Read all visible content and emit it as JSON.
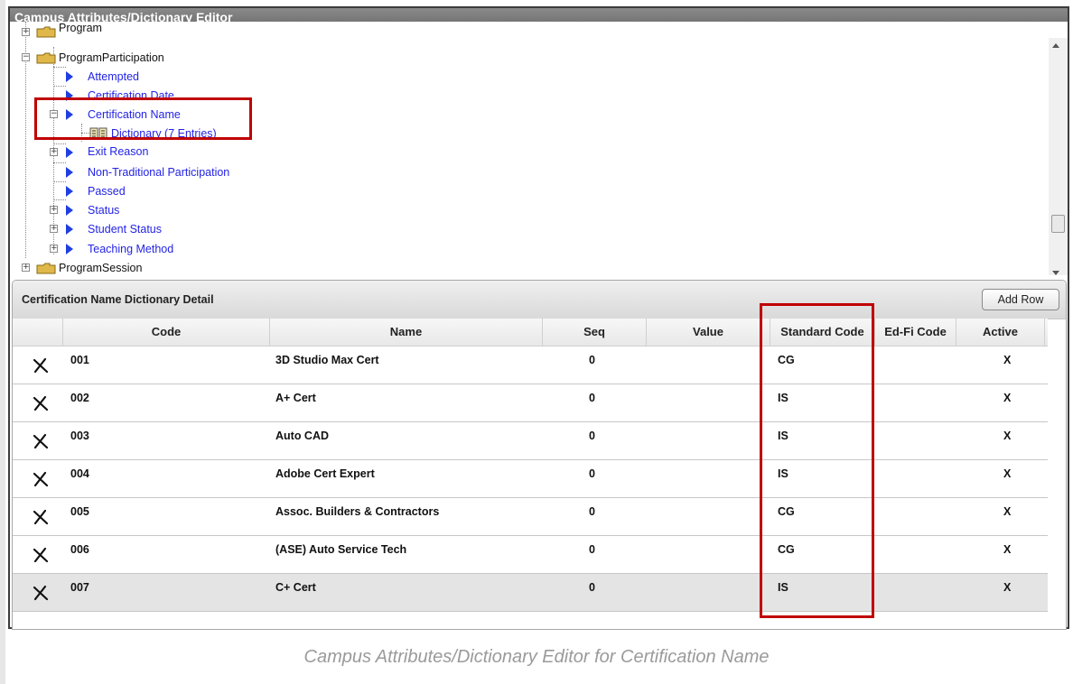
{
  "window": {
    "title": "Campus Attributes/Dictionary Editor"
  },
  "tree": {
    "items": [
      {
        "label": "Program",
        "kind": "folder",
        "expander": "+"
      },
      {
        "label": "ProgramParticipation",
        "kind": "folder",
        "expander": "−"
      },
      {
        "label": "Attempted",
        "kind": "attribute"
      },
      {
        "label": "Certification Date",
        "kind": "attribute"
      },
      {
        "label": "Certification Name",
        "kind": "attribute",
        "expander": "−"
      },
      {
        "label": "Dictionary (7 Entries)",
        "kind": "dictionary"
      },
      {
        "label": "Exit Reason",
        "kind": "attribute",
        "expander": "+"
      },
      {
        "label": "Non-Traditional Participation",
        "kind": "attribute"
      },
      {
        "label": "Passed",
        "kind": "attribute"
      },
      {
        "label": "Status",
        "kind": "attribute",
        "expander": "+"
      },
      {
        "label": "Student Status",
        "kind": "attribute",
        "expander": "+"
      },
      {
        "label": "Teaching Method",
        "kind": "attribute",
        "expander": "+"
      },
      {
        "label": "ProgramSession",
        "kind": "folder",
        "expander": "+"
      }
    ]
  },
  "detail": {
    "title": "Certification Name Dictionary Detail",
    "add_row_label": "Add Row",
    "columns": [
      "Code",
      "Name",
      "Seq",
      "Value",
      "Standard Code",
      "Ed-Fi Code",
      "Active"
    ],
    "rows": [
      {
        "code": "001",
        "name": "3D Studio Max Cert",
        "seq": "0",
        "value": "",
        "standard_code": "CG",
        "edfi_code": "",
        "active": "X"
      },
      {
        "code": "002",
        "name": "A+ Cert",
        "seq": "0",
        "value": "",
        "standard_code": "IS",
        "edfi_code": "",
        "active": "X"
      },
      {
        "code": "003",
        "name": "Auto CAD",
        "seq": "0",
        "value": "",
        "standard_code": "IS",
        "edfi_code": "",
        "active": "X"
      },
      {
        "code": "004",
        "name": "Adobe Cert Expert",
        "seq": "0",
        "value": "",
        "standard_code": "IS",
        "edfi_code": "",
        "active": "X"
      },
      {
        "code": "005",
        "name": "Assoc. Builders & Contractors",
        "seq": "0",
        "value": "",
        "standard_code": "CG",
        "edfi_code": "",
        "active": "X"
      },
      {
        "code": "006",
        "name": "(ASE) Auto Service Tech",
        "seq": "0",
        "value": "",
        "standard_code": "CG",
        "edfi_code": "",
        "active": "X"
      },
      {
        "code": "007",
        "name": "C+ Cert",
        "seq": "0",
        "value": "",
        "standard_code": "IS",
        "edfi_code": "",
        "active": "X",
        "selected": true
      }
    ]
  },
  "caption": "Campus Attributes/Dictionary Editor for Certification Name",
  "colors": {
    "link": "#2323e6",
    "highlight": "#c00000",
    "titlebar": "#7a7a7a"
  }
}
